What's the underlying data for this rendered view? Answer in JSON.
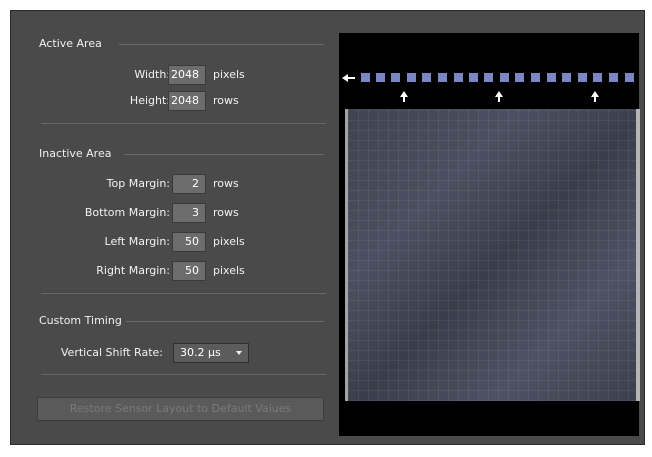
{
  "active_area": {
    "title": "Active Area",
    "width_label": "Width:",
    "width_value": "2048",
    "width_unit": "pixels",
    "height_label": "Height:",
    "height_value": "2048",
    "height_unit": "rows"
  },
  "inactive_area": {
    "title": "Inactive Area",
    "top_margin_label": "Top Margin:",
    "top_margin_value": "2",
    "top_margin_unit": "rows",
    "bottom_margin_label": "Bottom Margin:",
    "bottom_margin_value": "3",
    "bottom_margin_unit": "rows",
    "left_margin_label": "Left Margin:",
    "left_margin_value": "50",
    "left_margin_unit": "pixels",
    "right_margin_label": "Right Margin:",
    "right_margin_value": "50",
    "right_margin_unit": "pixels"
  },
  "custom_timing": {
    "title": "Custom Timing",
    "vertical_shift_rate_label": "Vertical Shift Rate:",
    "vertical_shift_rate_value": "30.2 µs"
  },
  "restore_button_label": "Restore Sensor Layout to Default Values",
  "colors": {
    "panel": "#4a4a4a",
    "field": "#6c6c6c",
    "pixel": "#7b86c4",
    "preview_bg": "#000000"
  }
}
